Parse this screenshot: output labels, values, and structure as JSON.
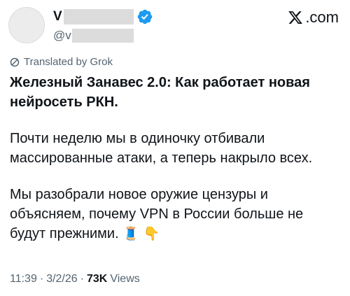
{
  "header": {
    "name_initial": "V",
    "handle_prefix": "@v",
    "brand": ".com"
  },
  "translation": {
    "label": "Translated by Grok"
  },
  "tweet": {
    "title": "Железный Занавес 2.0: Как работает новая\nнейросеть РКН.",
    "paragraph1": "Почти неделю мы в одиночку отбивали\nмассированные атаки, а теперь накрыло всех.",
    "paragraph2": "Мы разобрали новое оружие цензуры и\nобъясняем, почему VPN в России больше не\nбудут прежними.",
    "emojis": "🧵 👇"
  },
  "meta": {
    "time": "11:39",
    "separator": "·",
    "date": "3/2/26",
    "views_count": "73K",
    "views_label": "Views"
  },
  "colors": {
    "verified": "#1d9bf0",
    "secondary_text": "#536471",
    "primary_text": "#0f1419"
  },
  "icons": [
    "verified-badge-icon",
    "x-logo-icon",
    "translate-icon"
  ]
}
